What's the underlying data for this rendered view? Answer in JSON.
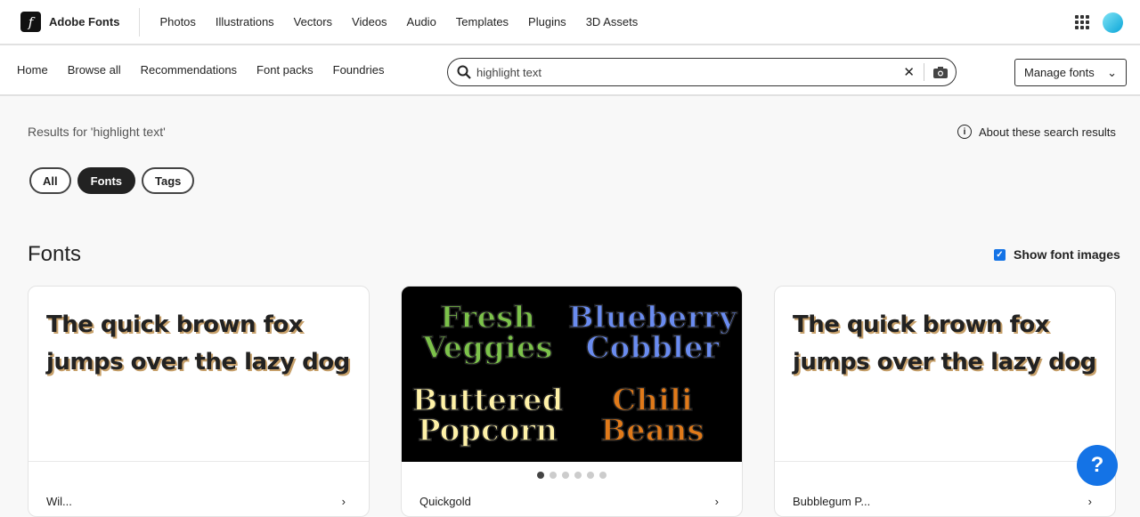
{
  "topnav": {
    "brand": "Adobe Fonts",
    "logo_letter": "f",
    "links": [
      "Photos",
      "Illustrations",
      "Vectors",
      "Videos",
      "Audio",
      "Templates",
      "Plugins",
      "3D Assets"
    ]
  },
  "subnav": {
    "links": [
      "Home",
      "Browse all",
      "Recommendations",
      "Font packs",
      "Foundries"
    ],
    "search_value": "highlight text",
    "manage_label": "Manage fonts"
  },
  "results_text": "Results for 'highlight text'",
  "about_label": "About these search results",
  "filters": [
    {
      "label": "All",
      "active": false
    },
    {
      "label": "Fonts",
      "active": true
    },
    {
      "label": "Tags",
      "active": false
    }
  ],
  "section_title": "Fonts",
  "show_images_label": "Show font images",
  "cards": [
    {
      "sample": "The quick brown fox jumps over the lazy dog",
      "name": "Wil..."
    },
    {
      "image_words": [
        "Fresh Veggies",
        "Blueberry Cobbler",
        "Buttered Popcorn",
        "Chili Beans"
      ],
      "name": "Quickgold"
    },
    {
      "sample": "The quick brown fox jumps over the lazy dog",
      "name": "Bubblegum P..."
    }
  ],
  "colors": {
    "accent": "#1473e6"
  }
}
